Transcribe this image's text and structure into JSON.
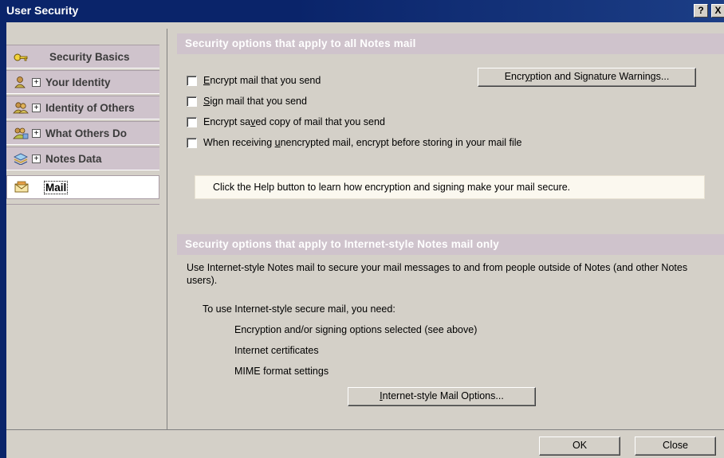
{
  "window": {
    "title": "User Security",
    "help_button": "?",
    "close_button": "X"
  },
  "sidebar": {
    "items": [
      {
        "label": "Security Basics",
        "icon": "key-icon",
        "expandable": false
      },
      {
        "label": "Your Identity",
        "icon": "person-icon",
        "expandable": true
      },
      {
        "label": "Identity of Others",
        "icon": "people-icon",
        "expandable": true
      },
      {
        "label": "What Others Do",
        "icon": "group-icon",
        "expandable": true
      },
      {
        "label": "Notes Data",
        "icon": "data-icon",
        "expandable": true
      },
      {
        "label": "Mail",
        "icon": "mail-icon",
        "expandable": false,
        "selected": true
      }
    ]
  },
  "section1": {
    "heading": "Security options that apply to all Notes mail",
    "checkboxes": [
      {
        "pre": "",
        "ul": "E",
        "post": "ncrypt mail that you send",
        "checked": false
      },
      {
        "pre": "",
        "ul": "S",
        "post": "ign mail that you send",
        "checked": false
      },
      {
        "pre": "Encrypt sa",
        "ul": "v",
        "post": "ed copy of mail that you send",
        "checked": false
      },
      {
        "pre": "When receiving ",
        "ul": "u",
        "post": "nencrypted mail, encrypt before storing in your mail file",
        "checked": false
      }
    ],
    "warnings_button": {
      "pre": "Encr",
      "ul": "y",
      "post": "ption and Signature Warnings..."
    },
    "help_text": "Click the Help button to learn how encryption and signing make your mail secure."
  },
  "section2": {
    "heading": "Security options that apply to Internet-style Notes mail only",
    "description": "Use Internet-style Notes mail to secure your mail messages to and from people outside of Notes (and other Notes users).",
    "need_intro": "To use Internet-style secure mail, you need:",
    "needs": [
      "Encryption and/or signing options selected (see above)",
      "Internet certificates",
      "MIME format settings"
    ],
    "options_button": {
      "pre": "",
      "ul": "I",
      "post": "nternet-style Mail Options..."
    }
  },
  "footer": {
    "ok_label": "OK",
    "close_label": "Close"
  }
}
